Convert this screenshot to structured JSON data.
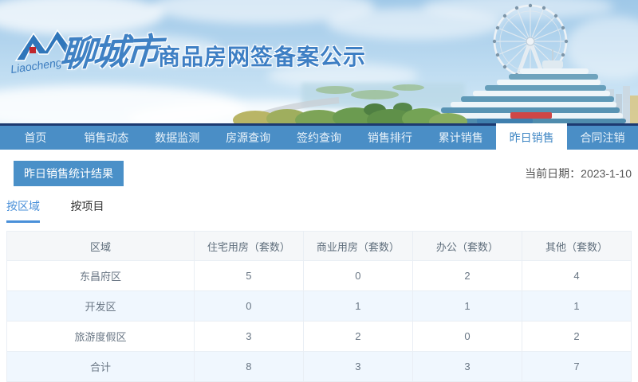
{
  "hero": {
    "logo_script": "Liaocheng",
    "city_name": "聊城市",
    "banner_title": "商品房网签备案公示"
  },
  "nav": {
    "items": [
      {
        "label": "首页",
        "active": false
      },
      {
        "label": "销售动态",
        "active": false
      },
      {
        "label": "数据监测",
        "active": false
      },
      {
        "label": "房源查询",
        "active": false
      },
      {
        "label": "签约查询",
        "active": false
      },
      {
        "label": "销售排行",
        "active": false
      },
      {
        "label": "累计销售",
        "active": false
      },
      {
        "label": "昨日销售",
        "active": true
      },
      {
        "label": "合同注销",
        "active": false
      }
    ]
  },
  "page": {
    "section_title": "昨日销售统计结果",
    "current_date_label": "当前日期：2023-1-10"
  },
  "tabs": [
    {
      "label": "按区域",
      "active": true
    },
    {
      "label": "按项目",
      "active": false
    }
  ],
  "table": {
    "columns": [
      "区域",
      "住宅用房（套数）",
      "商业用房（套数）",
      "办公（套数）",
      "其他（套数）"
    ],
    "rows": [
      [
        "东昌府区",
        "5",
        "0",
        "2",
        "4"
      ],
      [
        "开发区",
        "0",
        "1",
        "1",
        "1"
      ],
      [
        "旅游度假区",
        "3",
        "2",
        "0",
        "2"
      ],
      [
        "合计",
        "8",
        "3",
        "3",
        "7"
      ]
    ]
  },
  "colors": {
    "nav_background": "#4a8ec6",
    "nav_top_border": "#1d3a70",
    "active_nav_text": "#3e86c4",
    "badge_background": "#4a90c8",
    "tab_accent": "#4a90d9",
    "table_border": "#e9eef4",
    "table_header_background": "#f5f7f9",
    "table_alt_row_background": "#f0f7fe",
    "brand_blue": "#3e7fc4"
  }
}
